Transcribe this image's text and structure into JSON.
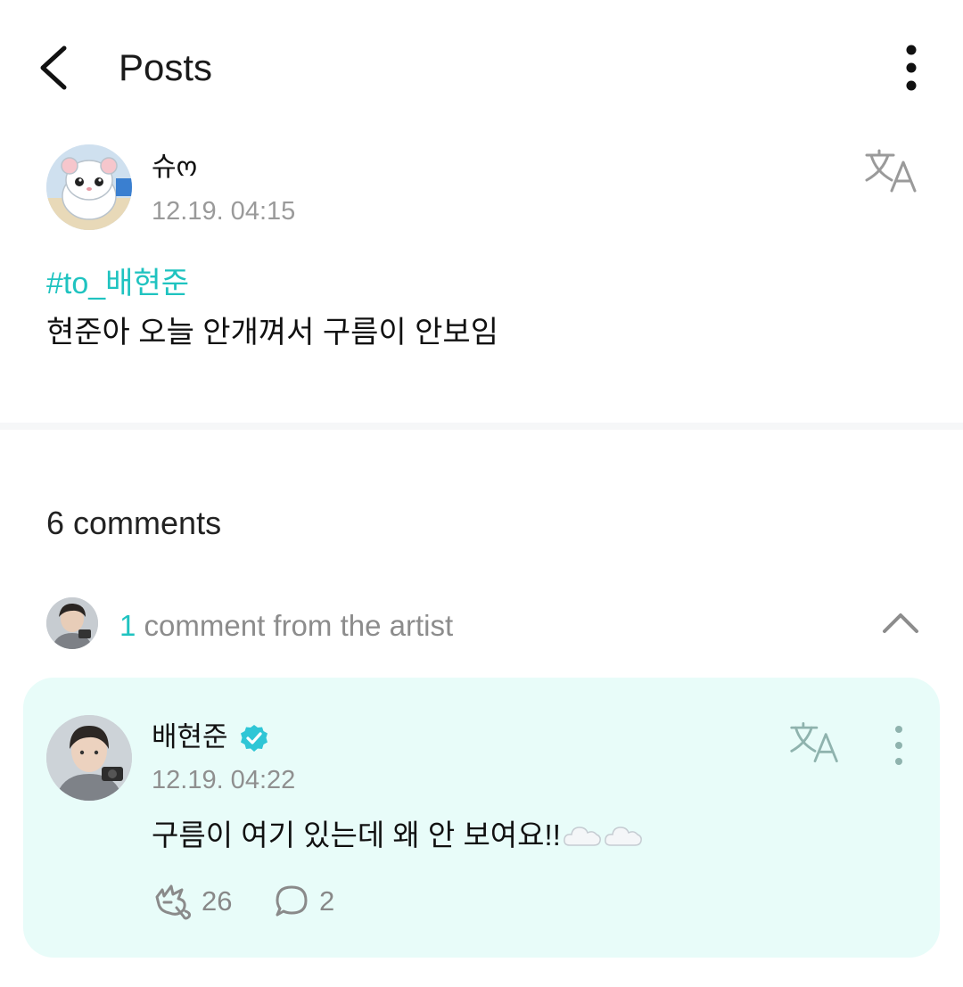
{
  "header": {
    "title": "Posts",
    "back_icon": "chevron-left-icon",
    "more_icon": "more-vertical-icon"
  },
  "post": {
    "author": "슈ო",
    "timestamp": "12.19. 04:15",
    "hashtag": "#to_배현준",
    "body": "현준아 오늘 안개껴서 구름이 안보임",
    "translate_icon": "translate-icon"
  },
  "comments": {
    "count_label": "6 comments"
  },
  "artist_section": {
    "count": "1",
    "label": " comment from the artist",
    "collapse_icon": "chevron-up-icon"
  },
  "artist_comment": {
    "author": "배현준",
    "verified_icon": "verified-badge-icon",
    "timestamp": "12.19. 04:22",
    "body": "구름이 여기 있는데 왜 안 보여요!!",
    "emoji_icons": [
      "cloud-icon",
      "cloud-icon"
    ],
    "likes": "26",
    "replies": "2",
    "like_icon": "like-icon",
    "reply_icon": "reply-icon"
  },
  "colors": {
    "accent": "#1fc3c0",
    "card_background": "#e8fcf9",
    "muted_text": "#9a9a9a",
    "verified": "#2fc6d6"
  }
}
